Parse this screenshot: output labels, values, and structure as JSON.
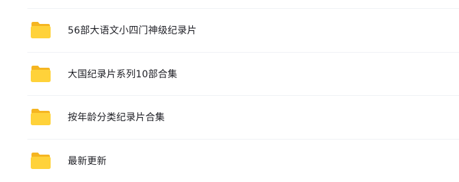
{
  "folders": {
    "items": [
      {
        "name": "56部大语文小四门神级纪录片",
        "icon": "folder-icon"
      },
      {
        "name": "大国纪录片系列10部合集",
        "icon": "folder-icon"
      },
      {
        "name": "按年龄分类纪录片合集",
        "icon": "folder-icon"
      },
      {
        "name": "最新更新",
        "icon": "folder-icon"
      }
    ]
  },
  "colors": {
    "folder_front": "#ffd23a",
    "folder_back": "#f5b521",
    "text": "#1d1e24",
    "divider": "#eff1f5"
  }
}
